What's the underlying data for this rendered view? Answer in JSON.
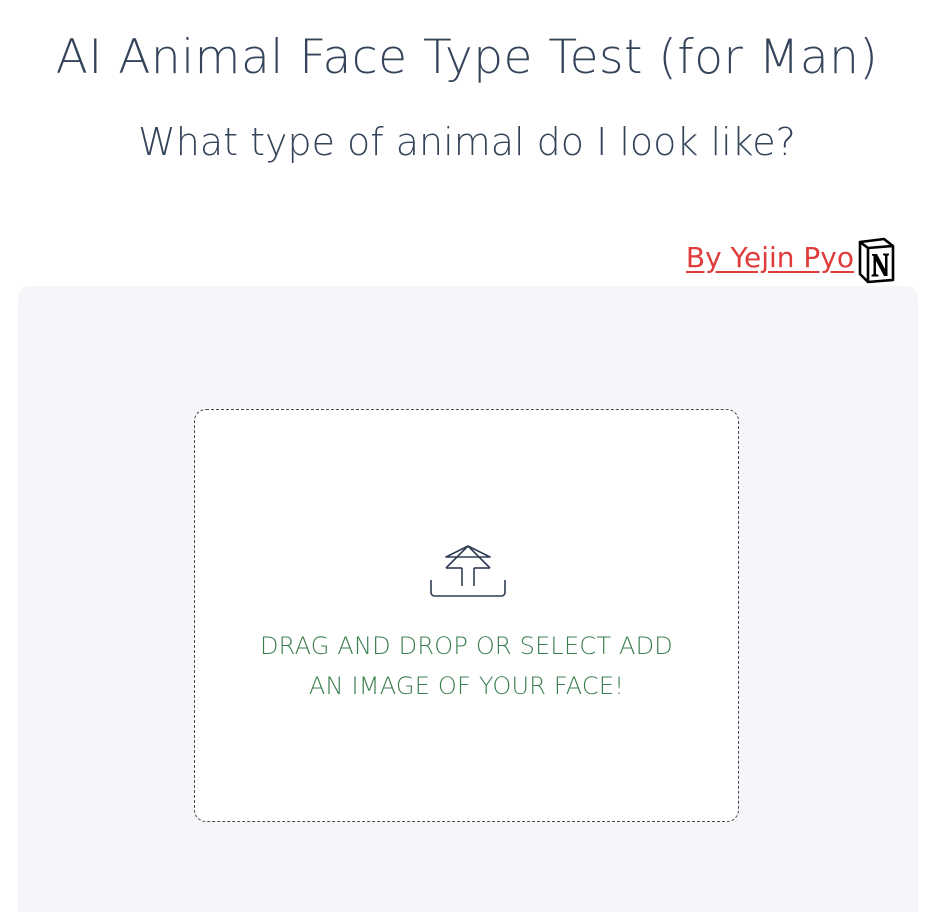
{
  "header": {
    "title": "AI Animal Face Type Test (for Man)",
    "subtitle": "What type of animal do I look like?"
  },
  "author": {
    "link_text": "By Yejin Pyo",
    "logo_icon": "notion-logo-icon",
    "link_color": "#e03c3c"
  },
  "upload": {
    "icon": "upload-icon",
    "instruction_line1": "DRAG AND DROP OR SELECT ADD",
    "instruction_line2": "AN IMAGE OF YOUR FACE!",
    "text_color": "#3b7d4f"
  },
  "colors": {
    "heading": "#34445a",
    "panel_background": "#f5f6f9"
  }
}
